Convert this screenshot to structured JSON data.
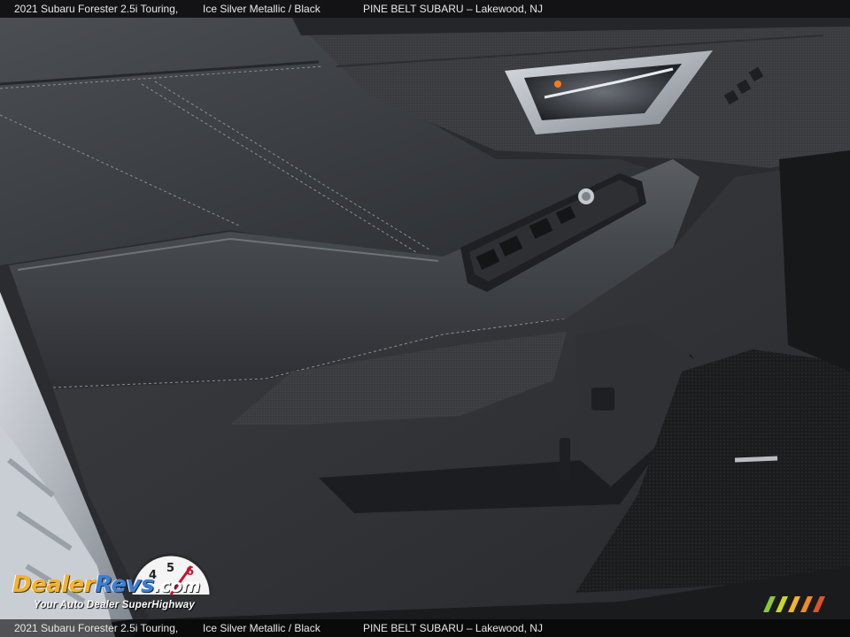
{
  "caption": {
    "model": "2021 Subaru Forester 2.5i Touring,",
    "color": "Ice Silver Metallic / Black",
    "dealer": "PINE BELT SUBARU – Lakewood, NJ"
  },
  "watermark": {
    "brand_part1": "Dealer",
    "brand_part2": "Revs",
    "brand_part3": ".com",
    "tagline": "Your Auto Dealer SuperHighway",
    "gauge_digits": [
      "4",
      "5",
      "6"
    ]
  },
  "colors": {
    "caption_text": "#e8e8e8",
    "brand_orange": "#f2b233",
    "brand_blue": "#3f7fd0",
    "stripe_colors": [
      "#8dc63f",
      "#c9d630",
      "#f2b233",
      "#f08a24",
      "#e0522a"
    ]
  },
  "scene": "car-door-interior-panel"
}
